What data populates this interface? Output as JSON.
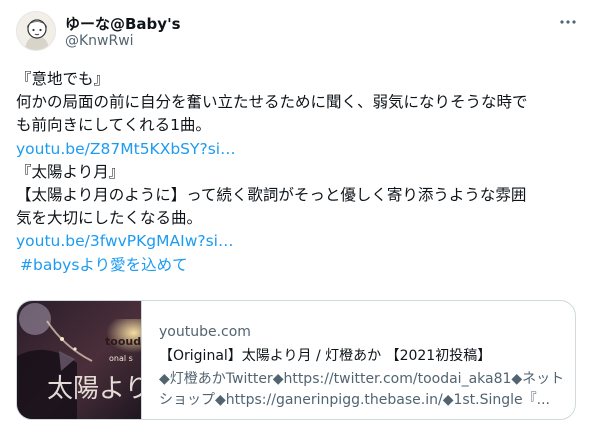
{
  "author": {
    "display_name": "ゆーな@Baby's",
    "handle": "@KnwRwi"
  },
  "icons": {
    "more": "more-horizontal-icon",
    "avatar": "avatar-illustration"
  },
  "tweet": {
    "lines": {
      "l1": "『意地でも』",
      "l2": "何かの局面の前に自分を奮い立たせるために聞く、弱気になりそうな時で",
      "l3": "も前向きにしてくれる1曲。",
      "l4": "youtu.be/Z87Mt5KXbSY?si…",
      "l5": "『太陽より月』",
      "l6": "【太陽より月のように】って続く歌詞がそっと優しく寄り添うような雰囲",
      "l7": "気を大切にしたくなる曲。",
      "l8": "youtu.be/3fwvPKgMAIw?si…",
      "l9": "#babysより愛を込めて"
    }
  },
  "card": {
    "domain": "youtube.com",
    "title": "【Original】太陽より月 / 灯橙あか 【2021初投稿】",
    "desc_line1": "◆灯橙あかTwitter◆https://twitter.com/toodai_aka81◆ネット",
    "desc_line2": "ショップ◆https://ganerinpigg.thebase.in/◆1st.Single『...",
    "thumb_text": "太陽より",
    "thumb_brand": "toouda",
    "thumb_sub": "onal s"
  },
  "colors": {
    "link": "#1d9bf0",
    "text": "#0f1419",
    "muted": "#536471",
    "border": "#cfd9de"
  }
}
